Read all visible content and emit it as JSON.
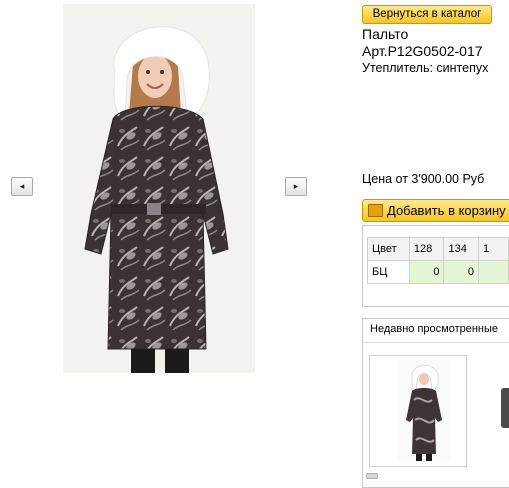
{
  "navigation": {
    "back_button": "Вернуться в каталог",
    "prev_arrow": "◂",
    "next_arrow": "▸"
  },
  "product": {
    "name": "Пальто",
    "article": "Арт.P12G0502-017",
    "insulation": "Утеплитель: синтепух",
    "price": "Цена от 3'900.00 Руб",
    "add_to_cart": "Добавить в корзину"
  },
  "size_table": {
    "header_label": "Цвет",
    "sizes": [
      "128",
      "134",
      "1"
    ],
    "rows": [
      {
        "color": "БЦ",
        "quantities": [
          "0",
          "0",
          ""
        ]
      }
    ]
  },
  "recently_viewed": {
    "title": "Недавно просмотренные"
  },
  "colors": {
    "button_yellow": "#f6c61c",
    "quantity_green": "#e6f6d4",
    "coat_dark": "#3d3436",
    "fur_white": "#ffffff"
  },
  "icons": [
    "cart-icon",
    "left-arrow-icon",
    "right-arrow-icon"
  ]
}
